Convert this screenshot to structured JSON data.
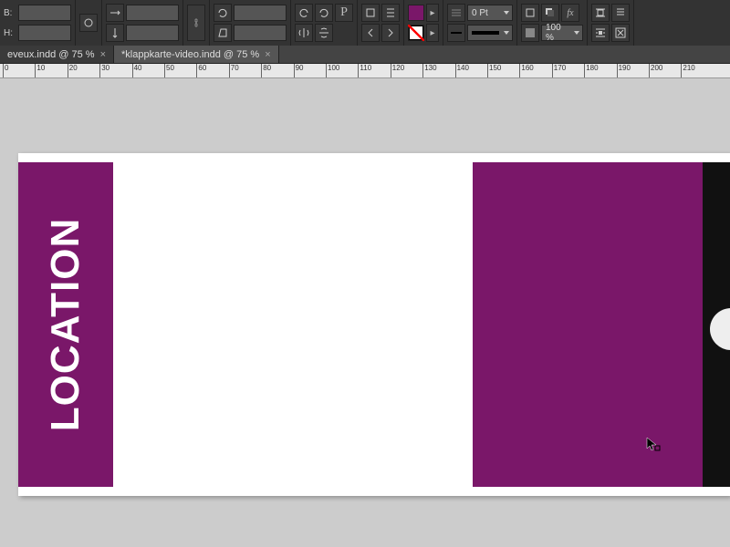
{
  "colors": {
    "panel_purple": "#7a1769",
    "swatch_fill": "#7a1769",
    "swatch_none": "#ffffff"
  },
  "toolbar": {
    "width_label": "B:",
    "height_label": "H:",
    "width_value": "",
    "height_value": "",
    "flip_h": "",
    "flip_v": "",
    "rotate_value": "",
    "stroke_weight": "0 Pt",
    "opacity": "100 %"
  },
  "tabs": [
    {
      "label": "eveux.indd @ 75 %",
      "active": false
    },
    {
      "label": "*klappkarte-video.indd @ 75 %",
      "active": true
    }
  ],
  "ruler": {
    "ticks": [
      "0",
      "10",
      "20",
      "30",
      "40",
      "50",
      "60",
      "70",
      "80",
      "90",
      "100",
      "110",
      "120",
      "130",
      "140",
      "150",
      "160",
      "170",
      "180",
      "190",
      "200",
      "210"
    ]
  },
  "document": {
    "sidebar_text": "LOCATION"
  }
}
